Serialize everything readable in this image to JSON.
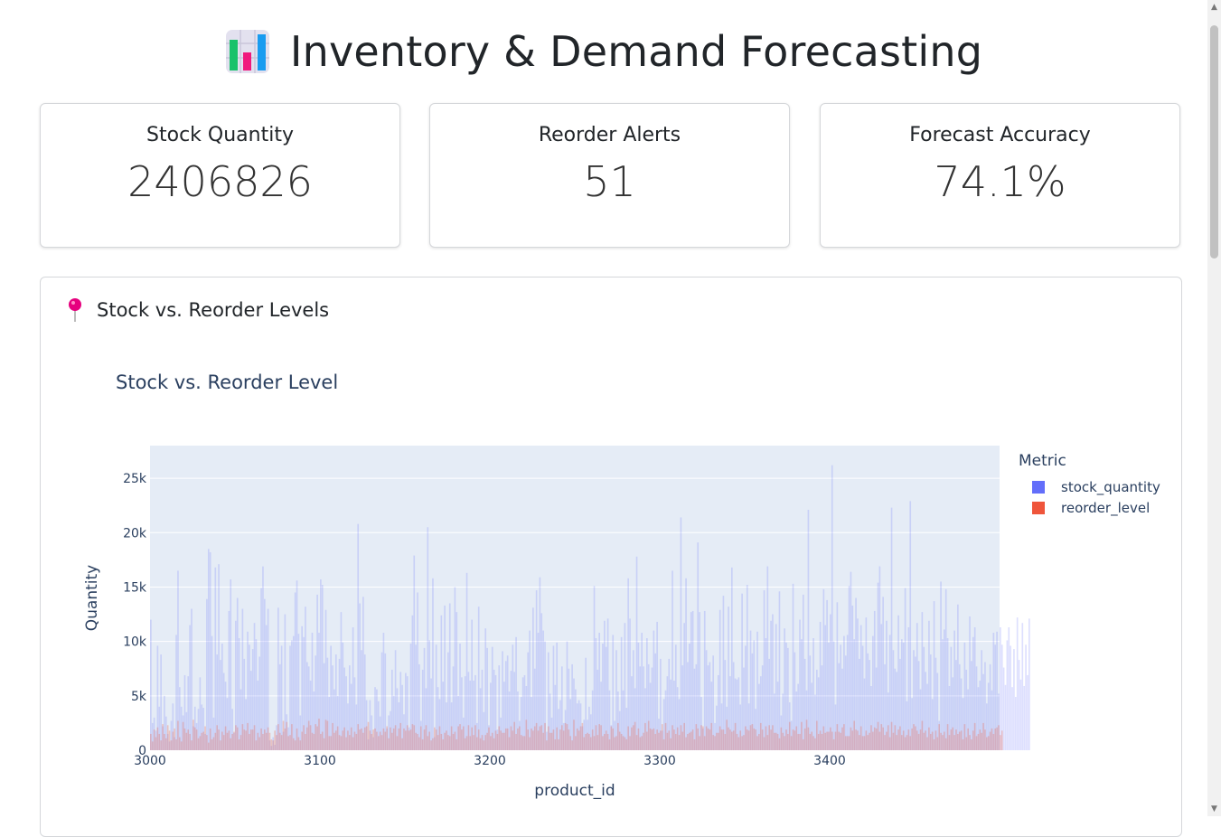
{
  "header": {
    "title": "Inventory & Demand Forecasting",
    "icon": "bar-chart-icon"
  },
  "kpis": [
    {
      "label": "Stock Quantity",
      "value": "2406826"
    },
    {
      "label": "Reorder Alerts",
      "value": "51"
    },
    {
      "label": "Forecast Accuracy",
      "value": "74.1%"
    }
  ],
  "panel": {
    "title": "Stock vs. Reorder Levels",
    "icon": "pushpin-icon"
  },
  "colors": {
    "stock": "#636efa",
    "reorder": "#ef553b",
    "plot_bg": "#e5ecf6",
    "pin": "#e6007e"
  },
  "chart_data": {
    "type": "bar",
    "title": "Stock vs. Reorder Level",
    "xlabel": "product_id",
    "ylabel": "Quantity",
    "legend_title": "Metric",
    "legend_position": "right",
    "xlim": [
      3000,
      3500
    ],
    "ylim": [
      0,
      28000
    ],
    "x_ticks": [
      3000,
      3100,
      3200,
      3300,
      3400
    ],
    "x_tick_labels": [
      "3000",
      "3100",
      "3200",
      "3300",
      "3400"
    ],
    "y_ticks": [
      0,
      5000,
      10000,
      15000,
      20000,
      25000
    ],
    "y_tick_labels": [
      "0",
      "5k",
      "10k",
      "15k",
      "20k",
      "25k"
    ],
    "grid": true,
    "series": [
      {
        "name": "stock_quantity",
        "values": [
          12000,
          2500,
          3000,
          1800,
          9600,
          4000,
          8800,
          2200,
          5000,
          3100,
          1500,
          800,
          2700,
          4300,
          1200,
          10600,
          16500,
          5800,
          4000,
          3200,
          6900,
          3500,
          6800,
          11500,
          13000,
          2200,
          4000,
          2500,
          3800,
          6700,
          4200,
          3900,
          1500,
          13900,
          18500,
          18200,
          10500,
          3000,
          16800,
          8800,
          17100,
          8300,
          9800,
          7100,
          6300,
          4800,
          12800,
          15700,
          3800,
          1600,
          11900,
          14000,
          10300,
          5600,
          13000,
          8400,
          4700,
          10900,
          9700,
          7300,
          9300,
          11700,
          10200,
          6400,
          8600,
          14900,
          16900,
          13900,
          11500,
          13000,
          900,
          400,
          1200,
          500,
          2300,
          13100,
          7900,
          9600,
          1700,
          12500,
          3300,
          2100,
          9600,
          10100,
          10500,
          14500,
          15600,
          10700,
          3200,
          11400,
          10400,
          13200,
          8100,
          7700,
          6400,
          10800,
          5400,
          8700,
          14300,
          10800,
          15700,
          15200,
          8000,
          12900,
          8500,
          4900,
          9600,
          7800,
          5600,
          8800,
          5000,
          8400,
          12700,
          9900,
          7600,
          6800,
          4300,
          7800,
          6100,
          11300,
          6700,
          4200,
          20800,
          13500,
          9200,
          14100,
          8800,
          4600,
          1000,
          4600,
          3200,
          1200,
          5800,
          5600,
          4500,
          3100,
          9000,
          10800,
          8900,
          2000,
          3200,
          3600,
          7400,
          5000,
          9200,
          5700,
          4400,
          7200,
          6000,
          3300,
          7100,
          6800,
          2100,
          9800,
          12400,
          17900,
          9700,
          14500,
          7900,
          2700,
          7400,
          9400,
          5700,
          20500,
          10100,
          6600,
          15800,
          1200,
          9700,
          5800,
          4700,
          12400,
          6300,
          13300,
          4400,
          9000,
          13500,
          4400,
          7700,
          15000,
          12700,
          5000,
          9800,
          6700,
          3000,
          6800,
          16300,
          7200,
          6400,
          12000,
          6400,
          6900,
          2500,
          13200,
          5700,
          7400,
          3500,
          11200,
          9400,
          2300,
          6200,
          9500,
          7400,
          6900,
          1900,
          7800,
          3000,
          9100,
          6300,
          8200,
          8700,
          5400,
          7300,
          9700,
          7200,
          10400,
          5400,
          2700,
          4900,
          6700,
          6900,
          5900,
          9000,
          11000,
          4900,
          13100,
          7500,
          14700,
          10800,
          15900,
          12600,
          11000,
          10000,
          1700,
          9000,
          5200,
          3000,
          9600,
          6000,
          9900,
          3800,
          4600,
          7700,
          2500,
          3700,
          10000,
          7500,
          4700,
          7900,
          6600,
          5600,
          4300,
          4600,
          4300,
          2200,
          2800,
          8500,
          2800,
          4000,
          3300,
          5500,
          15100,
          10300,
          7400,
          10800,
          6300,
          9800,
          11900,
          9500,
          12100,
          5500,
          2300,
          10600,
          2700,
          9200,
          5400,
          3600,
          10400,
          5500,
          11700,
          3900,
          15800,
          12100,
          6800,
          9200,
          5700,
          17800,
          9900,
          7700,
          10800,
          7700,
          5700,
          10300,
          7900,
          6200,
          7600,
          11000,
          8900,
          11800,
          2900,
          8400,
          1800,
          4700,
          5500,
          6800,
          8400,
          6500,
          16500,
          6400,
          9700,
          5800,
          4700,
          21400,
          7800,
          11700,
          15800,
          8100,
          9800,
          12700,
          12800,
          7500,
          7900,
          19100,
          12700,
          4900,
          2000,
          12800,
          9200,
          7800,
          8100,
          6300,
          8700,
          2500,
          4100,
          6900,
          12900,
          4300,
          14200,
          8300,
          4000,
          13200,
          6800,
          16800,
          8100,
          6600,
          6500,
          6700,
          4200,
          14400,
          7600,
          9600,
          15200,
          4300,
          11000,
          8900,
          10100,
          3800,
          10900,
          6100,
          6800,
          7800,
          14700,
          10300,
          16900,
          8400,
          11900,
          12500,
          5200,
          11600,
          6300,
          14600,
          3200,
          5200,
          11200,
          9900,
          9400,
          4400,
          2700,
          15300,
          9000,
          5400,
          6100,
          12000,
          10200,
          14300,
          8400,
          5500,
          22100,
          8700,
          6200,
          10300,
          5100,
          7400,
          6700,
          11800,
          7800,
          14800,
          11500,
          13800,
          9900,
          12500,
          26200,
          10000,
          4200,
          13600,
          8000,
          9700,
          7500,
          10500,
          8700,
          10600,
          15100,
          16400,
          13300,
          10200,
          14000,
          12100,
          8400,
          11500,
          9600,
          6600,
          12200,
          8900,
          8300,
          5900,
          10500,
          12800,
          7600,
          15400,
          16900,
          11600,
          14100,
          7900,
          11900,
          5300,
          10600,
          22300,
          9200,
          7500,
          7200,
          12400,
          8400,
          10200,
          9900,
          14900,
          4500,
          11300,
          22900,
          4800,
          9200,
          8600,
          11700,
          8200,
          5600,
          12700,
          9500,
          7200,
          6100,
          11900,
          8800,
          4700,
          13700,
          8500,
          7100,
          2700,
          15500,
          10200,
          11100,
          14800,
          10300,
          5900,
          9500,
          6700,
          11000,
          8300,
          13400,
          7900,
          6600,
          4800,
          9900,
          7400,
          5600,
          12300,
          8200,
          10400,
          11300,
          7700,
          5800,
          6400,
          9200,
          7000,
          8100,
          4300,
          6200,
          7900,
          5500,
          10800,
          9700,
          10900,
          5200,
          11300,
          9700,
          7600,
          6000,
          10100,
          11300,
          9600,
          5800,
          9300,
          4900,
          12200,
          8300,
          6500,
          11700,
          5900,
          9700,
          6900,
          12100
        ],
        "color": "#636efa"
      },
      {
        "name": "reorder_level",
        "values": [
          1500,
          800,
          1900,
          1200,
          2100,
          1500,
          900,
          2400,
          1500,
          1100,
          2300,
          1800,
          900,
          1700,
          2000,
          1000,
          2700,
          1200,
          800,
          2600,
          2000,
          1600,
          1900,
          1500,
          900,
          2800,
          2100,
          1900,
          1100,
          1300,
          1600,
          1700,
          2200,
          1400,
          700,
          2000,
          1000,
          1200,
          1600,
          2300,
          1900,
          900,
          1700,
          1400,
          2200,
          1600,
          1800,
          1100,
          1500,
          1700,
          2300,
          2100,
          1000,
          1400,
          2400,
          1900,
          1800,
          2500,
          1500,
          1900,
          1900,
          2300,
          900,
          1600,
          1200,
          2000,
          1500,
          1900,
          1600,
          2100,
          1600,
          1000,
          900,
          1800,
          1400,
          2400,
          1600,
          1400,
          2700,
          2000,
          2600,
          1300,
          1400,
          2400,
          1100,
          900,
          2000,
          1200,
          900,
          1700,
          2300,
          1500,
          2100,
          2700,
          2300,
          1600,
          1500,
          2400,
          2200,
          2900,
          1500,
          1700,
          1100,
          2800,
          2700,
          1300,
          1300,
          2500,
          1600,
          1800,
          2200,
          1400,
          1300,
          1800,
          2100,
          1200,
          1800,
          1400,
          2100,
          1200,
          1700,
          1500,
          2400,
          1900,
          2000,
          1600,
          2100,
          2200,
          2600,
          1800,
          1500,
          1900,
          2000,
          1700,
          1300,
          1700,
          1400,
          2000,
          1700,
          2200,
          1100,
          2100,
          1600,
          2000,
          2300,
          1300,
          2000,
          2500,
          1100,
          2000,
          1800,
          2300,
          1800,
          1900,
          2400,
          2300,
          1600,
          1500,
          1200,
          2200,
          1000,
          1900,
          2300,
          1300,
          1700,
          900,
          1100,
          2100,
          1900,
          1400,
          2200,
          1500,
          1000,
          1600,
          1800,
          1400,
          1300,
          2200,
          1500,
          1700,
          1000,
          2200,
          2400,
          1900,
          2200,
          1100,
          1300,
          2300,
          1300,
          2100,
          1400,
          2300,
          1200,
          1900,
          1100,
          1400,
          900,
          1400,
          1600,
          2100,
          1300,
          1600,
          1100,
          1800,
          1500,
          2200,
          1800,
          1600,
          1600,
          2000,
          2000,
          1200,
          2200,
          1800,
          2600,
          1500,
          2000,
          2200,
          1400,
          1300,
          1300,
          2800,
          1900,
          1200,
          2000,
          1800,
          2200,
          2500,
          1800,
          2200,
          2300,
          1600,
          2500,
          900,
          2200,
          1600,
          1600,
          1900,
          1000,
          2100,
          1000,
          1900,
          2300,
          1800,
          2500,
          2400,
          1900,
          1300,
          900,
          2800,
          1300,
          2000,
          1800,
          2200,
          2500,
          1200,
          1500,
          1600,
          1500,
          1200,
          1900,
          1300,
          2300,
          1400,
          2400,
          2300,
          1300,
          1500,
          1800,
          1500,
          1000,
          2200,
          2000,
          1200,
          1300,
          2500,
          1700,
          1500,
          1300,
          1200,
          1000,
          2200,
          1300,
          2100,
          2300,
          2600,
          1400,
          2000,
          1200,
          1300,
          1600,
          2500,
          1700,
          2700,
          2000,
          1900,
          2000,
          1500,
          1900,
          1600,
          1800,
          2400,
          1000,
          2500,
          1600,
          1800,
          1100,
          2300,
          1900,
          1500,
          2100,
          1400,
          2300,
          1700,
          2500,
          1200,
          1500,
          1600,
          1700,
          1900,
          1000,
          2400,
          2000,
          1300,
          2300,
          2200,
          1300,
          2200,
          2000,
          1900,
          2500,
          1400,
          1300,
          1600,
          1600,
          2200,
          1900,
          1900,
          1500,
          2800,
          2100,
          1900,
          1700,
          1800,
          2500,
          1500,
          1200,
          1800,
          1300,
          1400,
          2200,
          1900,
          1800,
          2300,
          2400,
          2000,
          1900,
          1300,
          1500,
          2500,
          1900,
          1200,
          2200,
          1400,
          2300,
          1900,
          2300,
          1600,
          1600,
          1500,
          1100,
          2100,
          1600,
          1300,
          1900,
          1500,
          2600,
          1300,
          1900,
          1800,
          2200,
          1500,
          1500,
          2600,
          1000,
          2000,
          2800,
          2100,
          1500,
          1700,
          1300,
          1100,
          2700,
          1500,
          1800,
          1500,
          2200,
          1600,
          1700,
          1700,
          2100,
          1700,
          1000,
          1700,
          2400,
          1700,
          1600,
          2100,
          2400,
          1300,
          1300,
          1300,
          2100,
          1800,
          2700,
          1900,
          1800,
          1400,
          2200,
          1300,
          1300,
          1800,
          1400,
          1600,
          2300,
          1700,
          2100,
          2000,
          2600,
          1700,
          2400,
          2100,
          1400,
          1700,
          2300,
          1200,
          2600,
          1600,
          2300,
          1400,
          1900,
          2200,
          1400,
          1800,
          1200,
          1400,
          1900,
          1300,
          2000,
          2400,
          2200,
          1800,
          1500,
          1900,
          2700,
          1600,
          1800,
          1200,
          2100,
          1500,
          1700,
          1000,
          1800,
          1200,
          2400,
          1600,
          1400,
          1700,
          1100,
          2400,
          1400,
          1900,
          2100,
          1400,
          1900,
          1500,
          1700,
          1800,
          1000,
          2400,
          1200,
          2000,
          1400,
          1000,
          1800,
          2500,
          1300,
          1500,
          1900,
          1600,
          2500,
          1900,
          1200,
          1300,
          1700,
          2000,
          1500,
          2000,
          2100,
          2300,
          1400,
          1800
        ],
        "color": "#ef553b"
      }
    ]
  }
}
